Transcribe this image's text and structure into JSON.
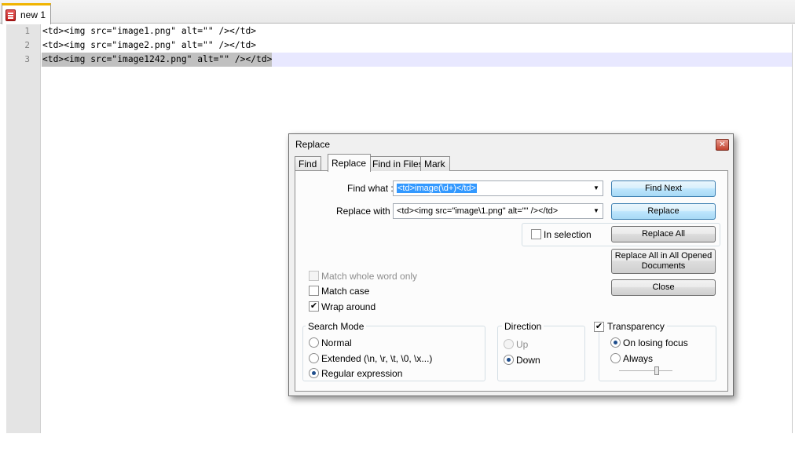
{
  "tabbar": {
    "tab_label": "new  1"
  },
  "editor": {
    "line_numbers": [
      "1",
      "2",
      "3"
    ],
    "lines": [
      "<td><img src=\"image1.png\" alt=\"\" /></td>",
      "<td><img src=\"image2.png\" alt=\"\" /></td>",
      "<td><img src=\"image1242.png\" alt=\"\" /></td>"
    ]
  },
  "dialog": {
    "title": "Replace",
    "tabs": [
      "Find",
      "Replace",
      "Find in Files",
      "Mark"
    ],
    "find_label": "Find what :",
    "find_value": "<td>image(\\d+)</td>",
    "replace_label": "Replace with :",
    "replace_value": "<td><img src=\"image\\1.png\" alt=\"\" /></td>",
    "buttons": {
      "find_next": "Find Next",
      "replace": "Replace",
      "replace_all": "Replace All",
      "replace_all_docs_line1": "Replace All in All Opened",
      "replace_all_docs_line2": "Documents",
      "close": "Close"
    },
    "in_selection": "In selection",
    "options": {
      "match_whole_word": "Match whole word only",
      "match_case": "Match case",
      "wrap_around": "Wrap around"
    },
    "search_mode": {
      "title": "Search Mode",
      "normal": "Normal",
      "extended": "Extended (\\n, \\r, \\t, \\0, \\x...)",
      "regex": "Regular expression"
    },
    "direction": {
      "title": "Direction",
      "up": "Up",
      "down": "Down"
    },
    "transparency": {
      "title": "Transparency",
      "on_losing_focus": "On losing focus",
      "always": "Always"
    }
  }
}
